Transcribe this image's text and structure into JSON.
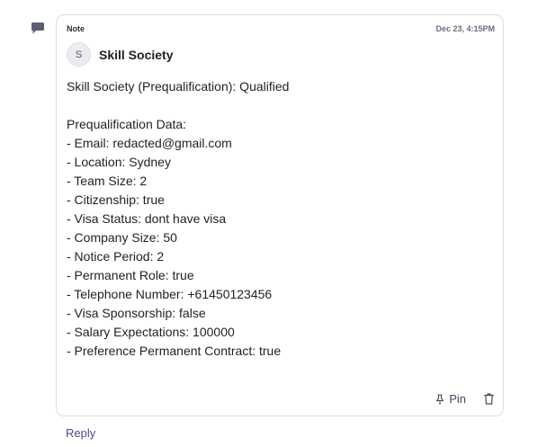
{
  "note": {
    "type_label": "Note",
    "timestamp": "Dec 23, 4:15PM",
    "avatar_initial": "S",
    "author": "Skill Society",
    "icon": "note-speech-bubble-icon",
    "body": {
      "headline": "Skill Society (Prequalification): Qualified",
      "section_title": "Prequalification Data:",
      "lines": [
        "- Email: redacted@gmail.com",
        "- Location: Sydney",
        "- Team Size: 2",
        "- Citizenship: true",
        "- Visa Status: dont have visa",
        "- Company Size: 50",
        "- Notice Period: 2",
        "- Permanent Role: true",
        "- Telephone Number: +61450123456",
        "- Visa Sponsorship: false",
        "- Salary Expectations: 100000",
        "- Preference Permanent Contract: true"
      ]
    },
    "actions": {
      "pin_label": "Pin",
      "pin_icon": "pin-icon",
      "delete_icon": "trash-icon"
    }
  },
  "reply_label": "Reply",
  "colors": {
    "icon_purple": "#5b5f78",
    "border": "#dcdde3",
    "link": "#4a4f86"
  }
}
